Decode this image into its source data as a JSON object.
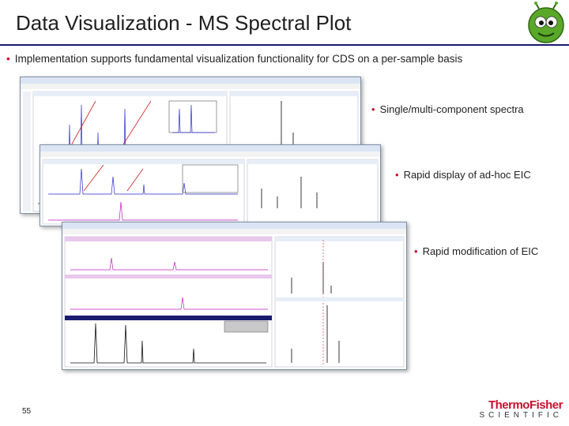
{
  "slide": {
    "title": "Data Visualization - MS Spectral Plot",
    "main_bullet": "Implementation supports fundamental visualization functionality for CDS on a per-sample basis",
    "side_bullets": [
      "Single/multi-component spectra",
      "Rapid display of ad-hoc EIC",
      "Rapid modification of EIC"
    ],
    "page_number": "55",
    "logo": {
      "line1": "ThermoFisher",
      "line2": "SCIENTIFIC"
    }
  },
  "colors": {
    "title_rule": "#1a1a6e",
    "bullet": "#c8102e",
    "brand_red": "#c8102e",
    "chrom_blue": "#2a2ad0",
    "chrom_magenta": "#c01cc0",
    "chrom_red": "#d02020"
  },
  "icons": [
    "green-alien-mascot-icon",
    "bullet-dot-icon"
  ]
}
